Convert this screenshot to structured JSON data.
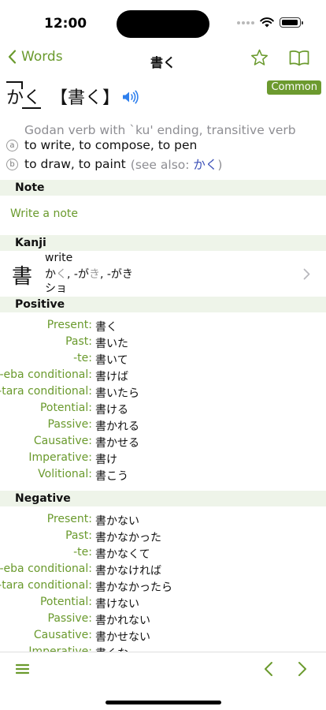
{
  "status": {
    "time": "12:00"
  },
  "nav": {
    "back_label": "Words",
    "title": "書く"
  },
  "entry": {
    "reading": "かく",
    "headword": "【書く】",
    "badge": "Common",
    "pos": "Godan verb with `ku' ending, transitive verb",
    "senses": [
      {
        "marker": "a",
        "text": "to write, to compose, to pen"
      },
      {
        "marker": "b",
        "text": "to draw, to paint",
        "see_also_prefix": "(see also: ",
        "see_also_link": "かく",
        "see_also_suffix": ")"
      }
    ]
  },
  "note": {
    "header": "Note",
    "placeholder": "Write a note"
  },
  "kanji": {
    "header": "Kanji",
    "character": "書",
    "meaning": "write",
    "kun_1": "か",
    "kun_1_okuri": "く",
    "kun_sep_1": ", -が",
    "kun_2_okuri": "き",
    "kun_sep_2": ", -がき",
    "on": "ショ"
  },
  "positive": {
    "header": "Positive",
    "rows": [
      {
        "label": "Present:",
        "value": "書く"
      },
      {
        "label": "Past:",
        "value": "書いた"
      },
      {
        "label": "-te:",
        "value": "書いて"
      },
      {
        "label": "-eba conditional:",
        "value": "書けば"
      },
      {
        "label": "-tara conditional:",
        "value": "書いたら"
      },
      {
        "label": "Potential:",
        "value": "書ける"
      },
      {
        "label": "Passive:",
        "value": "書かれる"
      },
      {
        "label": "Causative:",
        "value": "書かせる"
      },
      {
        "label": "Imperative:",
        "value": "書け"
      },
      {
        "label": "Volitional:",
        "value": "書こう"
      }
    ]
  },
  "negative": {
    "header": "Negative",
    "rows": [
      {
        "label": "Present:",
        "value": "書かない"
      },
      {
        "label": "Past:",
        "value": "書かなかった"
      },
      {
        "label": "-te:",
        "value": "書かなくて"
      },
      {
        "label": "-eba conditional:",
        "value": "書かなければ"
      },
      {
        "label": "-tara conditional:",
        "value": "書かなかったら"
      },
      {
        "label": "Potential:",
        "value": "書けない"
      },
      {
        "label": "Passive:",
        "value": "書かれない"
      },
      {
        "label": "Causative:",
        "value": "書かせない"
      },
      {
        "label": "Imperative:",
        "value": "書くな"
      }
    ]
  },
  "colors": {
    "accent": "#6a9a2d",
    "section_bg": "#eef4e9",
    "link": "#3a4fb7",
    "badge_bg": "#6c9a2f"
  },
  "icons": {
    "back": "chevron-left-icon",
    "favorite": "star-outline-icon",
    "reader": "book-open-icon",
    "audio": "speaker-icon",
    "disclosure": "chevron-right-icon",
    "menu": "hamburger-icon",
    "previous": "chevron-left-icon",
    "next": "chevron-right-icon"
  }
}
